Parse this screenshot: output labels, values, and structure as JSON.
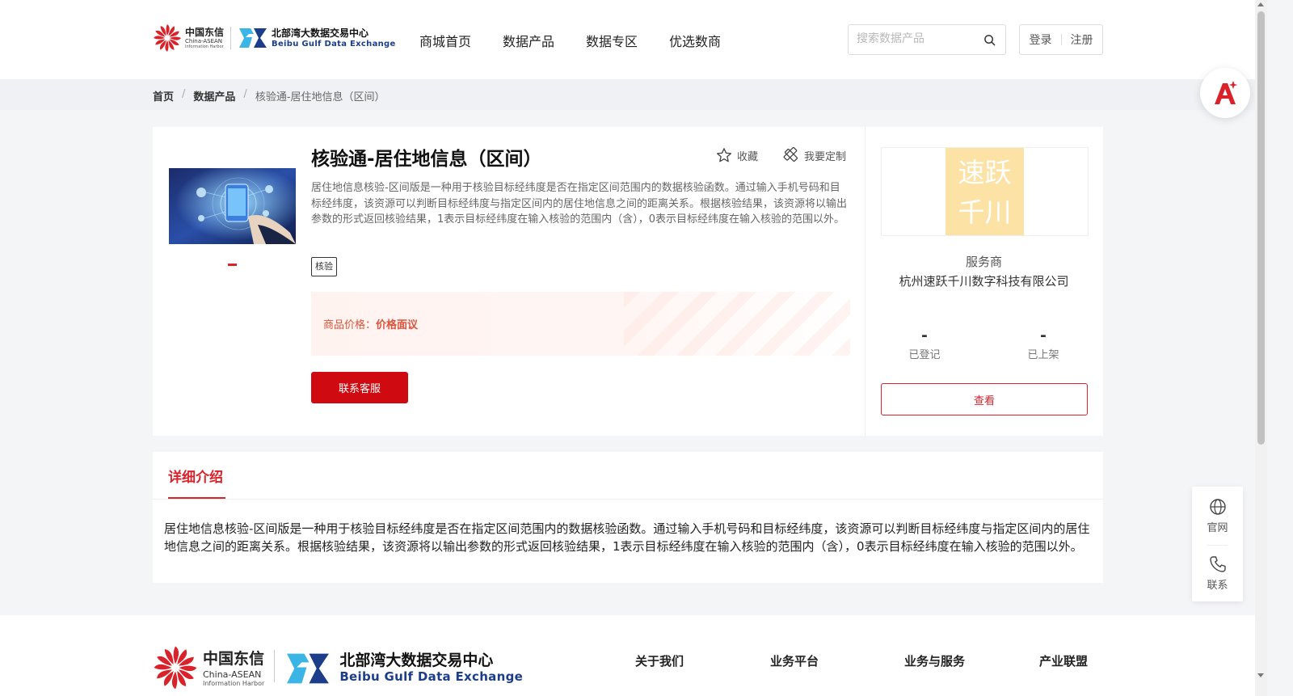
{
  "header": {
    "logo": {
      "china_telecom_cn": "中国东信",
      "china_telecom_en1": "China-ASEAN",
      "china_telecom_en2": "Information Harbor",
      "bgde_cn": "北部湾大数据交易中心",
      "bgde_en": "Beibu Gulf Data Exchange"
    },
    "nav": [
      "商城首页",
      "数据产品",
      "数据专区",
      "优选数商"
    ],
    "search": {
      "placeholder": "搜索数据产品",
      "value": ""
    },
    "login": "登录",
    "register": "注册"
  },
  "breadcrumb": {
    "items": [
      "首页",
      "数据产品"
    ],
    "current": "核验通-居住地信息（区间）"
  },
  "product": {
    "title": "核验通-居住地信息（区间）",
    "favorite_label": "收藏",
    "customize_label": "我要定制",
    "description": "居住地信息核验-区间版是一种用于核验目标经纬度是否在指定区间范围内的数据核验函数。通过输入手机号码和目标经纬度，该资源可以判断目标经纬度与指定区间内的居住地信息之间的距离关系。根据核验结果，该资源将以输出参数的形式返回核验结果，1表示目标经纬度在输入核验的范围内（含），0表示目标经纬度在输入核验的范围以外。",
    "tag": "核验",
    "price_label": "商品价格：",
    "price_value": "价格面议",
    "contact_button": "联系客服"
  },
  "provider": {
    "logo_text_line1": "速跃",
    "logo_text_line2": "千川",
    "type": "服务商",
    "name": "杭州速跃千川数字科技有限公司",
    "stats": [
      {
        "value": "-",
        "label": "已登记"
      },
      {
        "value": "-",
        "label": "已上架"
      }
    ],
    "view_button": "查看"
  },
  "detail": {
    "tab": "详细介绍",
    "text": "居住地信息核验-区间版是一种用于核验目标经纬度是否在指定区间范围内的数据核验函数。通过输入手机号码和目标经纬度，该资源可以判断目标经纬度与指定区间内的居住地信息之间的距离关系。根据核验结果，该资源将以输出参数的形式返回核验结果，1表示目标经纬度在输入核验的范围内（含），0表示目标经纬度在输入核验的范围以外。"
  },
  "side": {
    "official": "官网",
    "contact": "联系"
  },
  "footer": {
    "nav": [
      "关于我们",
      "业务平台",
      "业务与服务",
      "产业联盟"
    ]
  },
  "colors": {
    "brand_red": "#d9222a",
    "button_red": "#cf0a10",
    "price_orange": "#e0523a",
    "provider_logo_bg": "#fde2a5",
    "bgde_blue": "#1c3e8a"
  }
}
